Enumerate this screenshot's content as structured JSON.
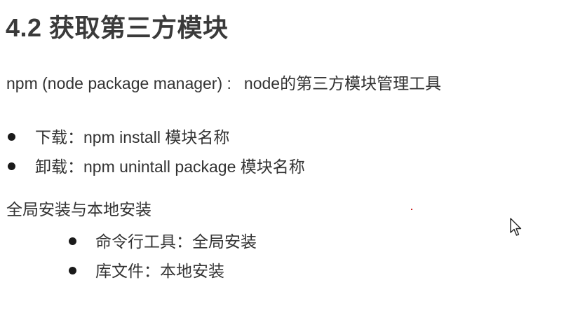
{
  "slide": {
    "title": "4.2 获取第三方模块",
    "intro": {
      "left": "npm (node package manager) :",
      "right": "node的第三方模块管理工具"
    },
    "bullets": [
      {
        "text": "下载：npm install 模块名称"
      },
      {
        "text": "卸载：npm unintall package 模块名称"
      }
    ],
    "section_heading": "全局安装与本地安装",
    "sub_bullets": [
      {
        "text": "命令行工具：全局安装"
      },
      {
        "text": "库文件：本地安装"
      }
    ]
  },
  "icons": {
    "cursor": "mouse-pointer-icon",
    "bullet": "bullet-dot-icon"
  },
  "colors": {
    "text": "#333333",
    "title": "#3a3a3a",
    "background": "#ffffff",
    "accent_dot": "#cc2222"
  }
}
